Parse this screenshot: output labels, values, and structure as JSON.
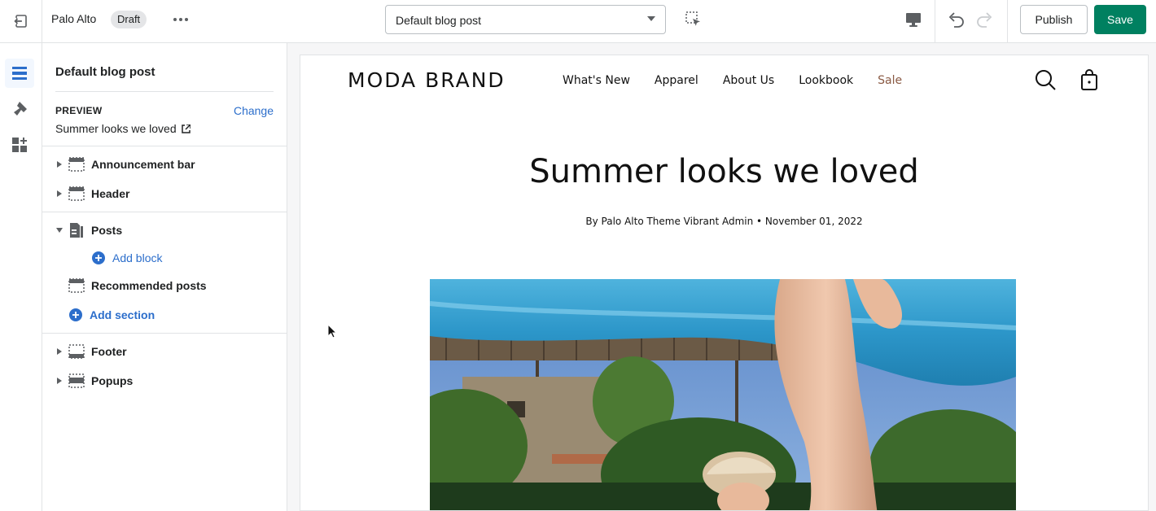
{
  "topbar": {
    "theme_name": "Palo Alto",
    "badge": "Draft",
    "template": "Default blog post",
    "publish_label": "Publish",
    "save_label": "Save"
  },
  "sidebar": {
    "title": "Default blog post",
    "preview_label": "PREVIEW",
    "change_label": "Change",
    "preview_value": "Summer looks we loved",
    "sections": [
      {
        "label": "Announcement bar",
        "expanded": false
      },
      {
        "label": "Header",
        "expanded": false
      },
      {
        "label": "Posts",
        "expanded": true
      },
      {
        "label": "Recommended posts"
      },
      {
        "label": "Footer",
        "expanded": false
      },
      {
        "label": "Popups",
        "expanded": false
      }
    ],
    "add_block": "Add block",
    "add_section": "Add section"
  },
  "store": {
    "brand": "MODA BRAND",
    "nav": [
      "What's New",
      "Apparel",
      "About Us",
      "Lookbook",
      "Sale"
    ],
    "article_title": "Summer looks we loved",
    "byline": "By Palo Alto Theme Vibrant Admin  •  November 01, 2022"
  },
  "colors": {
    "save": "#008060",
    "link": "#2c6ecb",
    "sale": "#8a5a44",
    "active_rail": "#2c6ecb"
  },
  "icons": [
    "exit-icon",
    "more-icon",
    "chevron-down-icon",
    "inspector-icon",
    "desktop-icon",
    "undo-icon",
    "redo-icon",
    "sections-icon",
    "theme-settings-icon",
    "apps-icon",
    "external-link-icon",
    "search-icon",
    "bag-icon",
    "plus-circle-icon"
  ]
}
